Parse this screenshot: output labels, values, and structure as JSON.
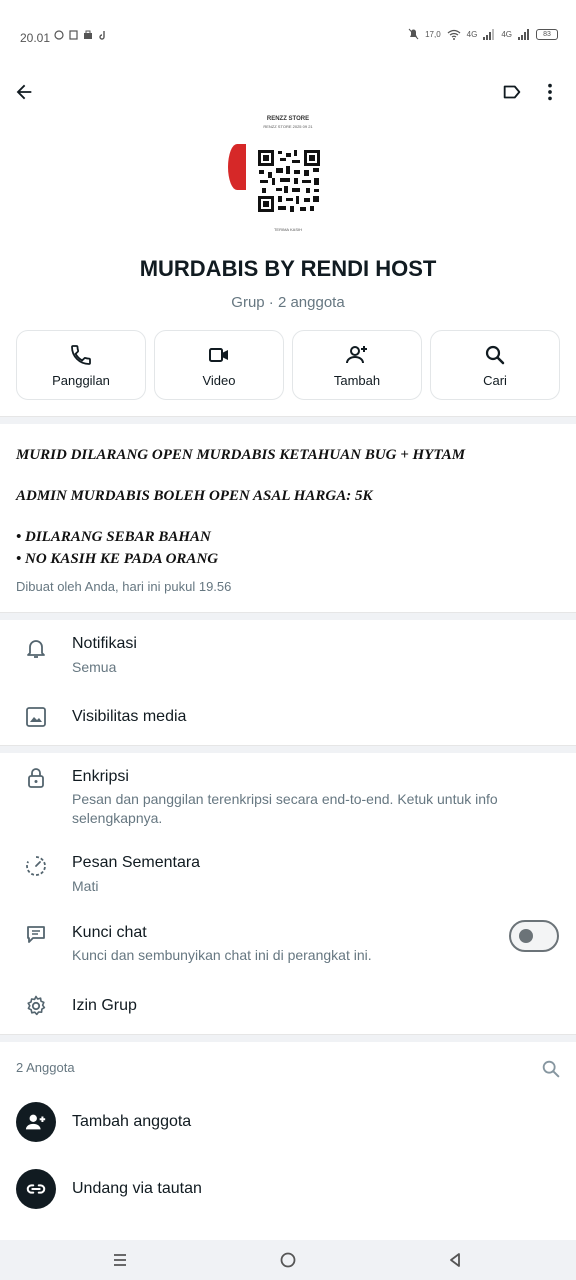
{
  "status_bar": {
    "time": "20.01",
    "speed": "17,0",
    "network_1": "4G",
    "network_2": "4G",
    "battery": "83"
  },
  "group": {
    "name": "MURDABIS BY RENDI HOST",
    "subtitle": "Grup · 2 anggota"
  },
  "group_photo": {
    "title": "RENZZ STORE",
    "subtitle": "RENZZ STORE 2025 09 21",
    "footer": "TERIMA KASIH"
  },
  "actions": [
    {
      "label": "Panggilan",
      "icon": "phone-icon"
    },
    {
      "label": "Video",
      "icon": "video-icon"
    },
    {
      "label": "Tambah",
      "icon": "add-person-icon"
    },
    {
      "label": "Cari",
      "icon": "search-icon"
    }
  ],
  "description": {
    "line1": "MURID DILARANG OPEN MURDABIS KETAHUAN BUG + HYTAM",
    "line2": "ADMIN MURDABIS BOLEH OPEN ASAL HARGA: 5K",
    "line3": "• DILARANG SEBAR BAHAN",
    "line4": "• NO KASIH KE PADA ORANG",
    "created": "Dibuat oleh Anda, hari ini pukul 19.56"
  },
  "settings": {
    "notifications": {
      "title": "Notifikasi",
      "value": "Semua"
    },
    "media_visibility": {
      "title": "Visibilitas media"
    },
    "encryption": {
      "title": "Enkripsi",
      "desc": "Pesan dan panggilan terenkripsi secara end-to-end. Ketuk untuk info selengkapnya."
    },
    "disappearing": {
      "title": "Pesan Sementara",
      "value": "Mati"
    },
    "chat_lock": {
      "title": "Kunci chat",
      "desc": "Kunci dan sembunyikan chat ini di perangkat ini.",
      "enabled": false
    },
    "group_permissions": {
      "title": "Izin Grup"
    }
  },
  "members": {
    "count_label": "2 Anggota",
    "add_member": "Tambah anggota",
    "invite_link": "Undang via tautan"
  },
  "colors": {
    "accent_dark": "#111b21",
    "secondary_text": "#667781",
    "divider": "#f0f2f5",
    "photo_red": "#d62828"
  }
}
